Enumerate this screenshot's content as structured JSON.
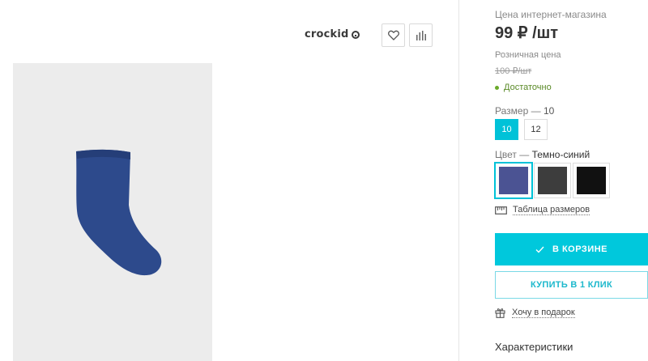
{
  "brand": {
    "logo_text": "crockid"
  },
  "actions": {
    "favorite_icon": "heart-icon",
    "compare_icon": "compare-bars-icon"
  },
  "product": {
    "image_alt": "sock",
    "image_color": "#2d4a8c"
  },
  "pricing": {
    "web_label": "Цена интернет-магазина",
    "web_price": "99 ₽ /шт",
    "retail_label": "Розничная цена",
    "retail_price": "100 ₽/шт",
    "stock": "Достаточно"
  },
  "size": {
    "label": "Размер",
    "dash": "—",
    "selected": "10",
    "options": [
      "10",
      "12"
    ]
  },
  "color": {
    "label": "Цвет",
    "dash": "—",
    "selected": "Темно-синий",
    "swatches": [
      "#4b5393",
      "#3d3d3d",
      "#111111"
    ]
  },
  "size_table": {
    "label": "Таблица размеров",
    "icon": "ruler-icon"
  },
  "buttons": {
    "cart": "В КОРЗИНЕ",
    "one_click": "КУПИТЬ В 1 КЛИК"
  },
  "gift": {
    "label": "Хочу в подарок",
    "icon": "gift-icon"
  },
  "specs": {
    "title": "Характеристики"
  },
  "colors": {
    "accent": "#00c8dc",
    "stock": "#6aaa2a"
  }
}
